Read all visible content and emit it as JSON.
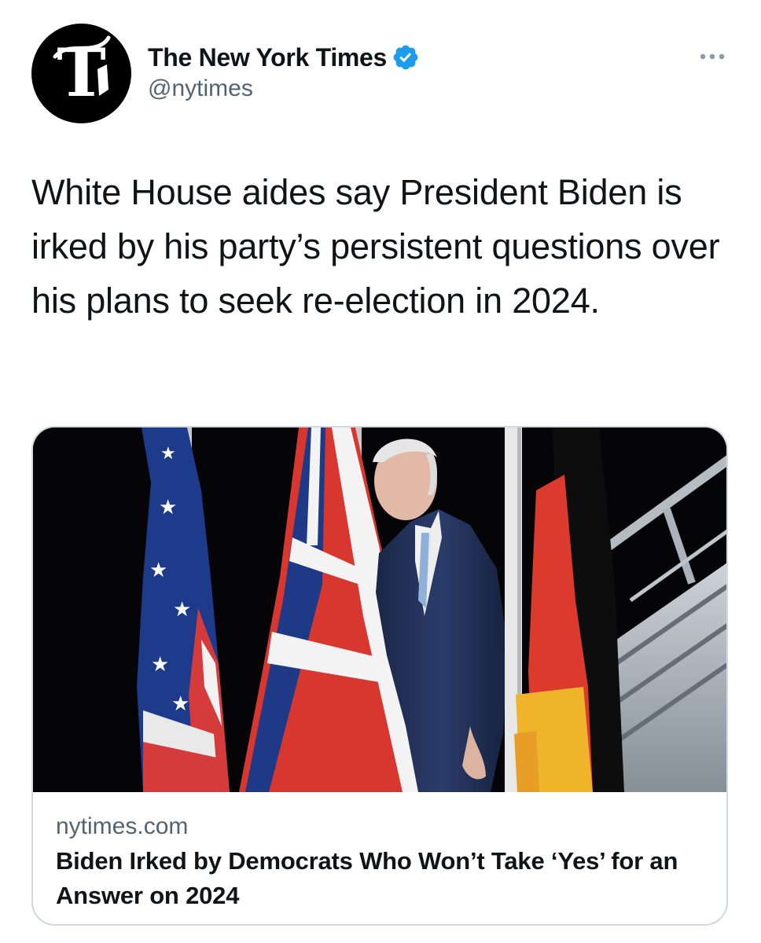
{
  "tweet": {
    "author": {
      "display_name": "The New York Times",
      "handle": "@nytimes",
      "verified": true,
      "avatar_icon": "nyt-logo-icon",
      "verified_icon": "verified-badge-icon",
      "verified_color": "#1d9bf0"
    },
    "more_icon": "more-options-icon",
    "text": "White House aides say President Biden is irked by his party’s persistent questions over his plans to seek re-election in 2024.",
    "card": {
      "domain": "nytimes.com",
      "title": "Biden Irked by Democrats Who Won’t Take ‘Yes’ for an Answer on 2024"
    }
  },
  "colors": {
    "text_primary": "#0f1419",
    "text_secondary": "#536471",
    "border": "#cfd9de",
    "verified_blue": "#1d9bf0"
  }
}
